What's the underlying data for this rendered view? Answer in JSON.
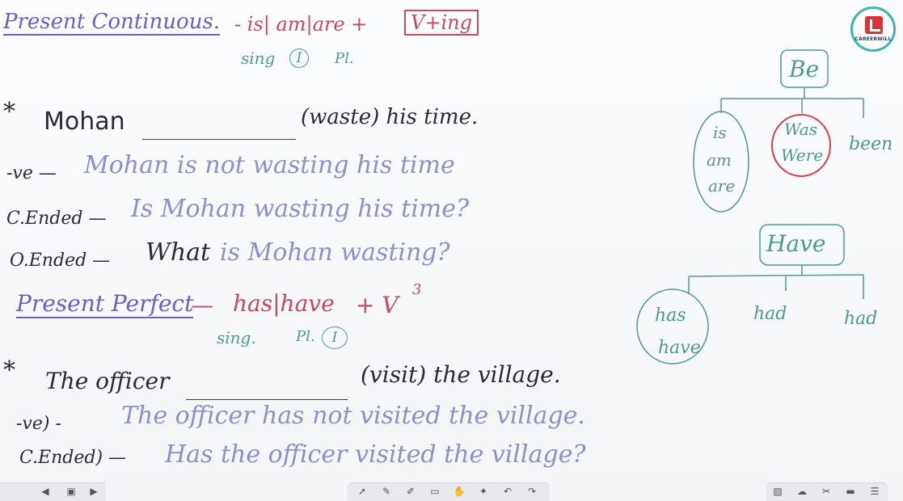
{
  "brand": {
    "logo_text": "CAREERWILL",
    "accent_color": "#3bb5b0",
    "logo_color": "#d8343a"
  },
  "present_continuous": {
    "title": "Present Continuous.",
    "formula_prefix": "- is| am|are +",
    "formula_box": "V+ing",
    "sing_label": "sing",
    "i_label": "I",
    "pl_label": "Pl."
  },
  "ex1": {
    "star": "*",
    "subject": "Mohan",
    "verb_hint": "(waste) his time.",
    "neg_label": "-ve —",
    "neg_text": "Mohan is not wasting his time",
    "closed_label": "C.Ended —",
    "closed_text": "Is Mohan wasting his time?",
    "open_label": "O.Ended —",
    "open_word": "What",
    "open_text": "is Mohan wasting?"
  },
  "present_perfect": {
    "title": "Present Perfect",
    "dash": "—",
    "formula": "has|have",
    "plus_v": "+ V",
    "superscript": "3",
    "sing_label": "sing.",
    "pl_label": "Pl.",
    "i_label": "I"
  },
  "ex2": {
    "star": "*",
    "subject": "The officer",
    "verb_hint": "(visit) the village.",
    "neg_label": "-ve) -",
    "neg_text": "The officer has not visited the village.",
    "closed_label": "C.Ended) —",
    "closed_text": "Has the officer visited the village?"
  },
  "be_tree": {
    "root": "Be",
    "left": [
      "is",
      "am",
      "are"
    ],
    "mid": [
      "Was",
      "Were"
    ],
    "right": "been"
  },
  "have_tree": {
    "root": "Have",
    "left": [
      "has",
      "have"
    ],
    "mid": "had",
    "right": "had"
  },
  "toolbar_icons": [
    "prev-icon",
    "next-icon",
    "pointer-icon",
    "pen-icon",
    "highlighter-icon",
    "eraser-icon",
    "hand-icon",
    "laser-icon",
    "undo-icon",
    "redo-icon",
    "image-icon",
    "cloud-icon",
    "tools-icon",
    "screen-icon",
    "menu-icon"
  ]
}
